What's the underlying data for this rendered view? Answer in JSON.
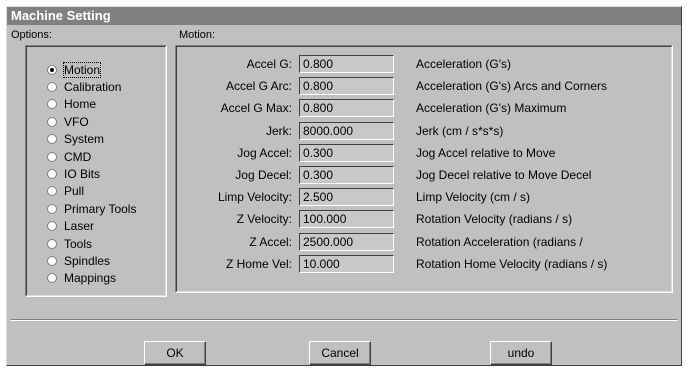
{
  "window": {
    "title": "Machine Setting"
  },
  "options": {
    "label": "Options:",
    "selected": "Motion",
    "items": [
      {
        "label": "Motion",
        "checked": true
      },
      {
        "label": "Calibration",
        "checked": false
      },
      {
        "label": "Home",
        "checked": false
      },
      {
        "label": "VFO",
        "checked": false
      },
      {
        "label": "System",
        "checked": false
      },
      {
        "label": "CMD",
        "checked": false
      },
      {
        "label": "IO Bits",
        "checked": false
      },
      {
        "label": "Pull",
        "checked": false
      },
      {
        "label": "Primary Tools",
        "checked": false
      },
      {
        "label": "Laser",
        "checked": false
      },
      {
        "label": "Tools",
        "checked": false
      },
      {
        "label": "Spindles",
        "checked": false
      },
      {
        "label": "Mappings",
        "checked": false
      }
    ]
  },
  "motion": {
    "label": "Motion:",
    "fields": [
      {
        "label": "Accel G:",
        "value": "0.800",
        "desc": "Acceleration (G's)"
      },
      {
        "label": "Accel G Arc:",
        "value": "0.800",
        "desc": "Acceleration (G's)  Arcs and Corners"
      },
      {
        "label": "Accel G Max:",
        "value": "0.800",
        "desc": "Acceleration (G's)  Maximum"
      },
      {
        "label": "Jerk:",
        "value": "8000.000",
        "desc": "Jerk (cm / s*s*s)"
      },
      {
        "label": "Jog Accel:",
        "value": "0.300",
        "desc": "Jog Accel relative to Move"
      },
      {
        "label": "Jog Decel:",
        "value": "0.300",
        "desc": "Jog Decel relative to Move Decel"
      },
      {
        "label": "Limp Velocity:",
        "value": "2.500",
        "desc": "Limp Velocity (cm / s)"
      },
      {
        "label": "Z Velocity:",
        "value": "100.000",
        "desc": "Rotation Velocity (radians / s)"
      },
      {
        "label": "Z Accel:",
        "value": "2500.000",
        "desc": "Rotation Acceleration (radians /"
      },
      {
        "label": "Z Home Vel:",
        "value": "10.000",
        "desc": "Rotation Home Velocity (radians / s)"
      }
    ]
  },
  "buttons": {
    "ok": "OK",
    "cancel": "Cancel",
    "undo": "undo"
  }
}
